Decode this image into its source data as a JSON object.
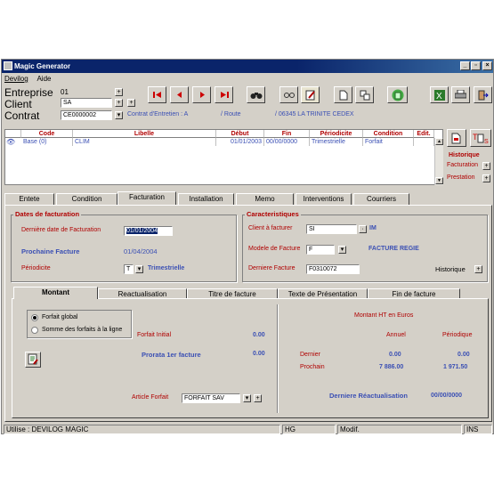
{
  "window": {
    "title": "Magic Generator"
  },
  "menu": [
    "Devilog",
    "Aide"
  ],
  "header": {
    "entreprise_label": "Entreprise",
    "entreprise_value": "01",
    "client_label": "Client",
    "client_value": "SA",
    "contrat_label": "Contrat",
    "contrat_value": "CE0000002",
    "contrat_info_1": "Contrat d'Entretien : A",
    "contrat_info_2": "/ Route",
    "contrat_info_3": "/ 06345 LA TRINITE CEDEX"
  },
  "grid": {
    "columns": [
      "Code",
      "Libelle",
      "Début",
      "Fin",
      "Périodicite",
      "Condition",
      "Edit."
    ],
    "rows": [
      [
        "Base (0)",
        "CLIM",
        "01/01/2003",
        "00/00/0000",
        "Trimestrielle",
        "Forfait",
        ""
      ]
    ]
  },
  "historique": {
    "title": "Historique",
    "items": [
      "Facturation",
      "Prestation"
    ]
  },
  "tabs": [
    "Entete",
    "Condition",
    "Facturation",
    "Installation",
    "Memo",
    "Interventions",
    "Courriers"
  ],
  "dates": {
    "group_title": "Dates de facturation",
    "derniere_label": "Dernière date de Facturation",
    "derniere_value": "01/01/2004",
    "prochaine_label": "Prochaine Facture",
    "prochaine_value": "01/04/2004",
    "periodicite_label": "Périodicite",
    "periodicite_code": "T",
    "periodicite_value": "Trimestrielle"
  },
  "caracteristiques": {
    "group_title": "Caracteristiques",
    "client_label": "Client à facturer",
    "client_value": "SI",
    "client_suffix": "IM",
    "modele_label": "Modele de Facture",
    "modele_value": "F",
    "modele_desc": "FACTURE REGIE",
    "derniere_label": "Derniere Facture",
    "derniere_value": "F0310072",
    "historique_label": "Historique"
  },
  "subtabs": [
    "Montant",
    "Reactualisation",
    "Titre de facture",
    "Texte de Présentation",
    "Fin de facture"
  ],
  "montant": {
    "radio_1": "Forfait global",
    "radio_2": "Somme des forfaits à la ligne",
    "forfait_initial_label": "Forfait Initial",
    "forfait_initial_value": "0.00",
    "prorata_label": "Prorata 1er facture",
    "prorata_value": "0.00",
    "article_label": "Article Forfait",
    "article_value": "FORFAIT SAV",
    "montant_ht_title": "Montant  HT en Euros",
    "col_annuel": "Annuel",
    "col_periodique": "Périodique",
    "dernier_label": "Dernier",
    "dernier_annuel": "0.00",
    "dernier_periodique": "0.00",
    "prochain_label": "Prochain",
    "prochain_annuel": "7 886.00",
    "prochain_periodique": "1 971.50",
    "reactualisation_label": "Derniere Réactualisation",
    "reactualisation_value": "00/00/0000"
  },
  "statusbar": {
    "user": "Utilise : DEVILOG MAGIC",
    "hg": "HG",
    "modif": "Modif.",
    "ins": "INS"
  }
}
